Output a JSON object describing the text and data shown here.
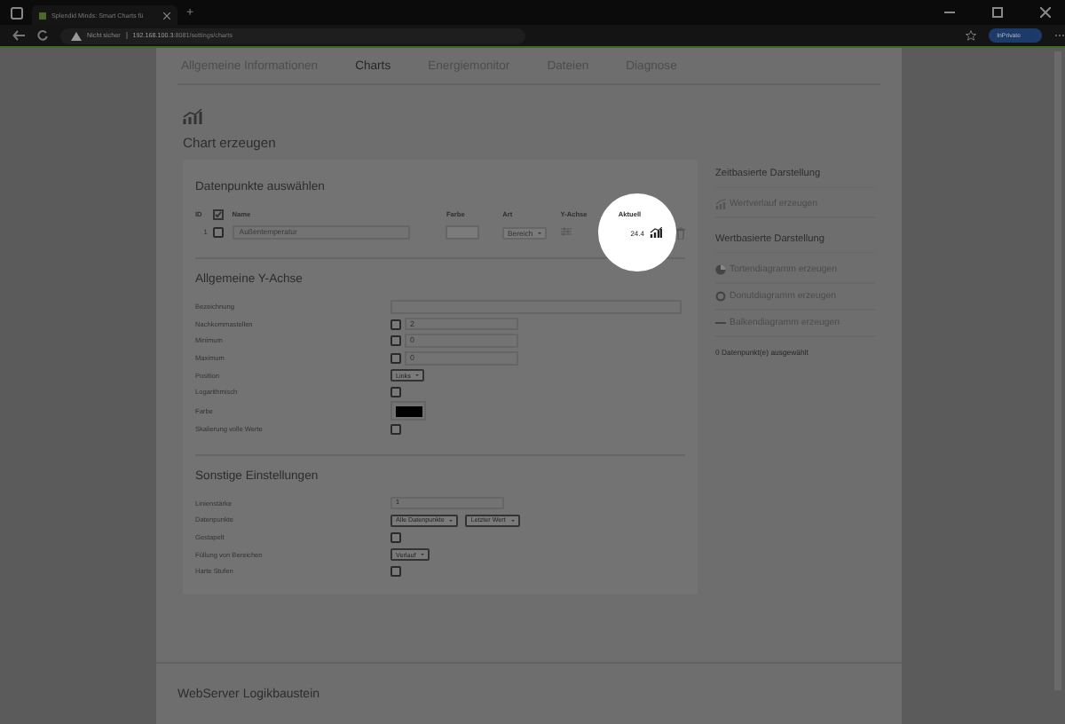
{
  "browser": {
    "tab_title": "Splendid Minds: Smart Charts fü",
    "new_tab": "+",
    "security": "Nicht sicher",
    "host": "192.168.100.3",
    "path": ":8081/settings/charts",
    "profile": "InPrivate"
  },
  "nav": [
    {
      "label": "Allgemeine Informationen",
      "selected": false
    },
    {
      "label": "Charts",
      "selected": true
    },
    {
      "label": "Energiemonitor",
      "selected": false
    },
    {
      "label": "Dateien",
      "selected": false
    },
    {
      "label": "Diagnose",
      "selected": false
    }
  ],
  "title": "Chart erzeugen",
  "datapoints": {
    "title": "Datenpunkte auswählen",
    "columns": [
      "ID",
      "Name",
      "Farbe",
      "Art",
      "Y-Achse",
      "Aktuell"
    ],
    "rows": [
      {
        "id": "1",
        "checked": false,
        "name": "Außentemperatur",
        "type": "Bereich",
        "current": "24.4",
        "highlighted": true
      }
    ]
  },
  "y_axis": {
    "title": "Allgemeine Y-Achse",
    "fields": [
      {
        "kind": "wide_text",
        "label": "Bezeichnung"
      },
      {
        "kind": "check_text",
        "label": "Nachkommastellen",
        "checked": false,
        "placeholder": "2"
      },
      {
        "kind": "check_text",
        "label": "Minimum",
        "checked": false,
        "placeholder": "0"
      },
      {
        "kind": "check_text",
        "label": "Maximum",
        "checked": false,
        "placeholder": "0"
      },
      {
        "kind": "select",
        "label": "Position",
        "options": [
          "Links"
        ]
      },
      {
        "kind": "check",
        "label": "Logarithmisch",
        "checked": false
      },
      {
        "kind": "color",
        "label": "Farbe",
        "color": "#000000"
      },
      {
        "kind": "check",
        "label": "Skalierung volle Werte",
        "checked": false
      }
    ]
  },
  "other": {
    "title": "Sonstige Einstellungen",
    "fields": [
      {
        "kind": "text",
        "label": "Linienstärke",
        "value": "1"
      },
      {
        "kind": "select",
        "label": "Datenpunkte",
        "options": [
          "Alle Datenpunkte",
          "Letzter Wert"
        ]
      },
      {
        "kind": "check",
        "label": "Gestapelt",
        "checked": false
      },
      {
        "kind": "select",
        "label": "Füllung von Bereichen",
        "options": [
          "Verlauf"
        ]
      },
      {
        "kind": "check",
        "label": "Harte Stufen",
        "checked": false
      }
    ]
  },
  "sidebar": {
    "sections": [
      {
        "title": "Zeitbasierte Darstellung",
        "items": [
          {
            "kind": "line",
            "label": "Wertverlauf erzeugen"
          }
        ]
      },
      {
        "title": "Wertbasierte Darstellung",
        "items": [
          {
            "kind": "pie",
            "label": "Tortendiagramm erzeugen"
          },
          {
            "kind": "donut",
            "label": "Donutdiagramm erzeugen"
          },
          {
            "kind": "bar",
            "label": "Balkendiagramm erzeugen"
          }
        ]
      }
    ],
    "footer": "0 Datenpunkt(e) ausgewählt"
  },
  "bottom_section": "WebServer Logikbaustein"
}
